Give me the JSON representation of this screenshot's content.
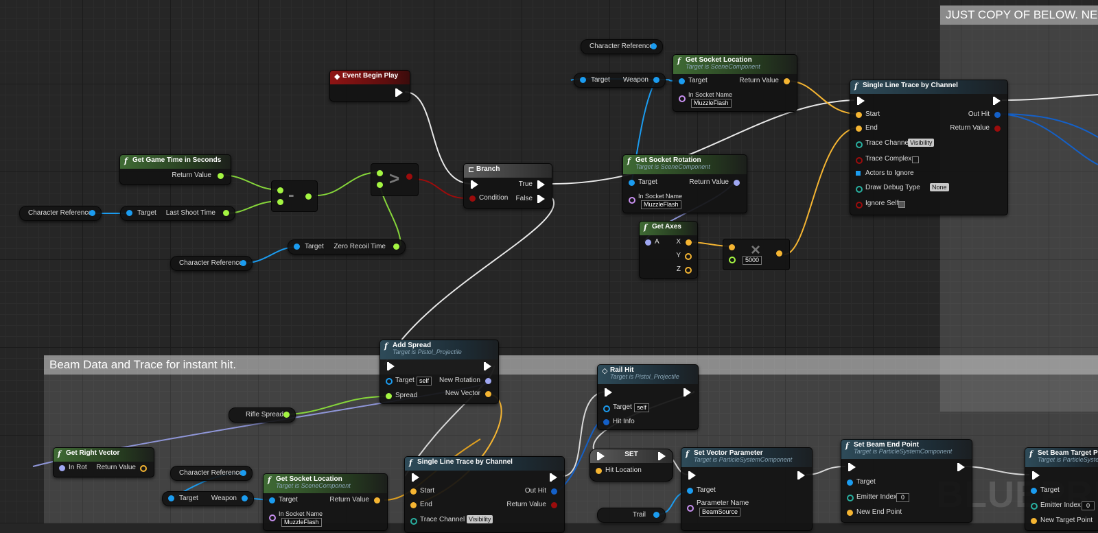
{
  "comments": {
    "top_right": "JUST COPY OF BELOW. NEE",
    "bottom": "Beam Data and Trace for instant hit."
  },
  "watermark": "BLUEPRINT",
  "colors": {
    "exec": "#ffffff",
    "object": "#1b9cf0",
    "float": "#a4f542",
    "vector": "#f5b532",
    "bool": "#9c0c0c",
    "rotator": "#9fa7f2",
    "struct": "#1460c8",
    "name": "#c890f0",
    "channel": "#28b0a0"
  },
  "nodes": {
    "get_game_time": {
      "title": "Get Game Time in Seconds",
      "return": "Return Value"
    },
    "char_ref_1": {
      "label": "Character Reference"
    },
    "last_shoot": {
      "target": "Target",
      "out": "Last Shoot Time"
    },
    "char_ref_2": {
      "label": "Character Reference"
    },
    "zero_recoil": {
      "target": "Target",
      "out": "Zero Recoil Time"
    },
    "event_begin": {
      "title": "Event Begin Play"
    },
    "branch": {
      "title": "Branch",
      "condition": "Condition",
      "true": "True",
      "false": "False"
    },
    "char_ref_3": {
      "label": "Character Reference"
    },
    "weapon_get": {
      "target": "Target",
      "out": "Weapon"
    },
    "socket_loc_1": {
      "title": "Get Socket Location",
      "sub": "Target is SceneComponent",
      "target": "Target",
      "return": "Return Value",
      "socket": "In Socket Name",
      "socket_val": "MuzzleFlash"
    },
    "socket_rot": {
      "title": "Get Socket Rotation",
      "sub": "Target is SceneComponent",
      "target": "Target",
      "return": "Return Value",
      "socket": "In Socket Name",
      "socket_val": "MuzzleFlash"
    },
    "get_axes": {
      "title": "Get Axes",
      "a": "A",
      "x": "X",
      "y": "Y",
      "z": "Z"
    },
    "mult": {
      "val": "5000"
    },
    "trace_top": {
      "title": "Single Line Trace by Channel",
      "start": "Start",
      "end": "End",
      "out_hit": "Out Hit",
      "return": "Return Value",
      "channel": "Trace Channel",
      "channel_val": "Visibility",
      "complex": "Trace Complex",
      "actors": "Actors to Ignore",
      "debug": "Draw Debug Type",
      "debug_val": "None",
      "ignore_self": "Ignore Self"
    },
    "add_spread": {
      "title": "Add Spread",
      "sub": "Target is Pistol_Projectile",
      "target": "Target",
      "self": "self",
      "spread": "Spread",
      "new_rot": "New Rotation",
      "new_vec": "New Vector"
    },
    "rifle_spread": {
      "label": "Rifle Spread"
    },
    "rail_hit": {
      "title": "Rail Hit",
      "sub": "Target is Pistol_Projectile",
      "target": "Target",
      "self": "self",
      "hit_info": "Hit Info"
    },
    "get_right": {
      "title": "Get Right Vector",
      "in": "In Rot",
      "return": "Return Value"
    },
    "char_ref_4": {
      "label": "Character Reference"
    },
    "weapon_get_2": {
      "target": "Target",
      "out": "Weapon"
    },
    "socket_loc_2": {
      "title": "Get Socket Location",
      "sub": "Target is SceneComponent",
      "target": "Target",
      "return": "Return Value",
      "socket": "In Socket Name",
      "socket_val": "MuzzleFlash"
    },
    "trace_bottom": {
      "title": "Single Line Trace by Channel",
      "start": "Start",
      "end": "End",
      "out_hit": "Out Hit",
      "return": "Return Value",
      "channel": "Trace Channel",
      "channel_val": "Visibility"
    },
    "set_node": {
      "title": "SET",
      "pin": "Hit Location"
    },
    "trail": {
      "label": "Trail"
    },
    "set_vector_param": {
      "title": "Set Vector Parameter",
      "sub": "Target is ParticleSystemComponent",
      "target": "Target",
      "param": "Parameter Name",
      "param_val": "BeamSource"
    },
    "set_beam_end": {
      "title": "Set Beam End Point",
      "sub": "Target is ParticleSystemComponent",
      "target": "Target",
      "emitter": "Emitter Index",
      "emitter_val": "0",
      "end": "New End Point"
    },
    "set_beam_target": {
      "title": "Set Beam Target Poi",
      "sub": "Target is ParticleSystemC",
      "target": "Target",
      "emitter": "Emitter Index",
      "emitter_val": "0",
      "target_pt": "New Target Point"
    }
  }
}
